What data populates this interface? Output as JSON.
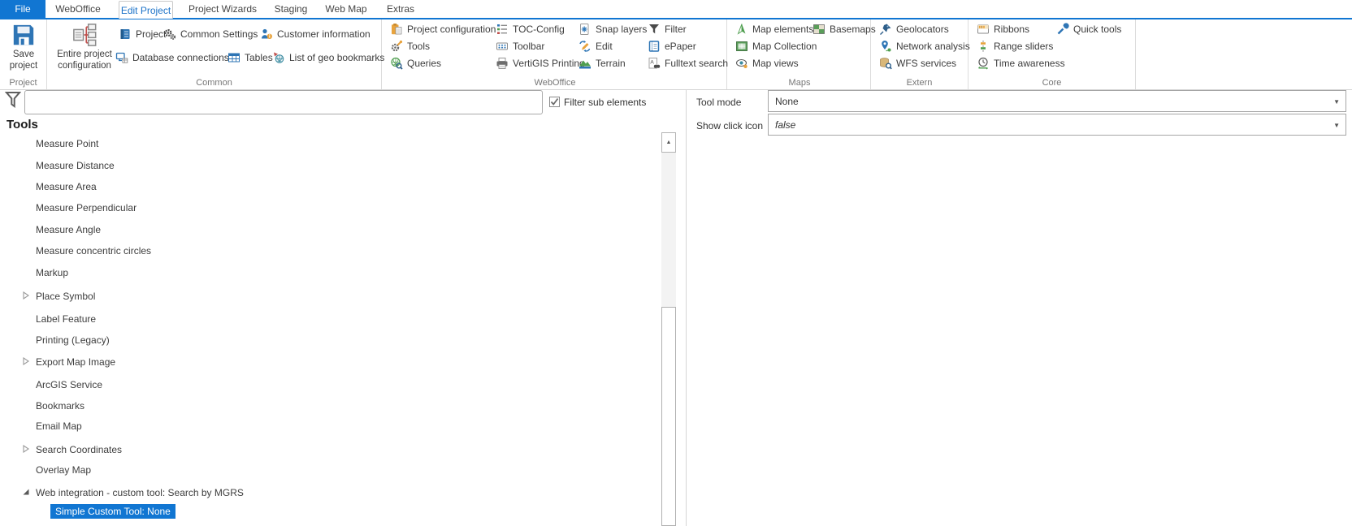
{
  "colors": {
    "accent": "#1176d2",
    "selected_tab_text": "#1b72c8"
  },
  "tabs": [
    "File",
    "WebOffice",
    "Edit Project",
    "Project Wizards",
    "Staging",
    "Web Map",
    "Extras"
  ],
  "ribbon": {
    "groups": [
      {
        "label": "Project",
        "buttons": [
          {
            "label": "Save project"
          }
        ]
      },
      {
        "label": "Common",
        "buttons": [
          {
            "label": "Entire project configuration"
          },
          {
            "label": "Project"
          },
          {
            "label": "Common Settings"
          },
          {
            "label": "Customer information"
          },
          {
            "label": "Database connections"
          },
          {
            "label": "Tables"
          },
          {
            "label": "List of geo bookmarks"
          }
        ]
      },
      {
        "label": "WebOffice",
        "buttons": [
          {
            "label": "Project configuration"
          },
          {
            "label": "Tools"
          },
          {
            "label": "Queries"
          },
          {
            "label": "TOC-Config"
          },
          {
            "label": "Toolbar"
          },
          {
            "label": "VertiGIS Printing"
          },
          {
            "label": "Snap layers"
          },
          {
            "label": "Edit"
          },
          {
            "label": "Terrain"
          },
          {
            "label": "Filter"
          },
          {
            "label": "ePaper"
          },
          {
            "label": "Fulltext search"
          }
        ]
      },
      {
        "label": "Maps",
        "buttons": [
          {
            "label": "Map elements"
          },
          {
            "label": "Map Collection"
          },
          {
            "label": "Map views"
          },
          {
            "label": "Basemaps"
          }
        ]
      },
      {
        "label": "Extern",
        "buttons": [
          {
            "label": "Geolocators"
          },
          {
            "label": "Network analysis"
          },
          {
            "label": "WFS services"
          }
        ]
      },
      {
        "label": "Core",
        "buttons": [
          {
            "label": "Ribbons"
          },
          {
            "label": "Range sliders"
          },
          {
            "label": "Time awareness"
          },
          {
            "label": "Quick tools"
          }
        ]
      }
    ]
  },
  "filter": {
    "input_value": "",
    "checkbox_label": "Filter sub elements",
    "checked": true
  },
  "tree": {
    "header": "Tools",
    "items": [
      {
        "label": "Measure Point"
      },
      {
        "label": "Measure Distance"
      },
      {
        "label": "Measure Area"
      },
      {
        "label": "Measure Perpendicular"
      },
      {
        "label": "Measure Angle"
      },
      {
        "label": "Measure concentric circles"
      },
      {
        "label": "Markup"
      },
      {
        "label": "Place Symbol",
        "expand": "collapsed"
      },
      {
        "label": "Label Feature"
      },
      {
        "label": "Printing (Legacy)"
      },
      {
        "label": "Export Map Image",
        "expand": "collapsed"
      },
      {
        "label": "ArcGIS Service"
      },
      {
        "label": "Bookmarks"
      },
      {
        "label": "Email Map"
      },
      {
        "label": "Search Coordinates",
        "expand": "collapsed"
      },
      {
        "label": "Overlay Map"
      },
      {
        "label": "Web integration - custom tool: Search by MGRS",
        "expand": "expanded"
      },
      {
        "label": "Simple Custom Tool: None",
        "child": true,
        "selected": true
      }
    ]
  },
  "properties": {
    "rows": [
      {
        "label": "Tool mode",
        "value": "None"
      },
      {
        "label": "Show click icon",
        "value": "false"
      }
    ]
  }
}
